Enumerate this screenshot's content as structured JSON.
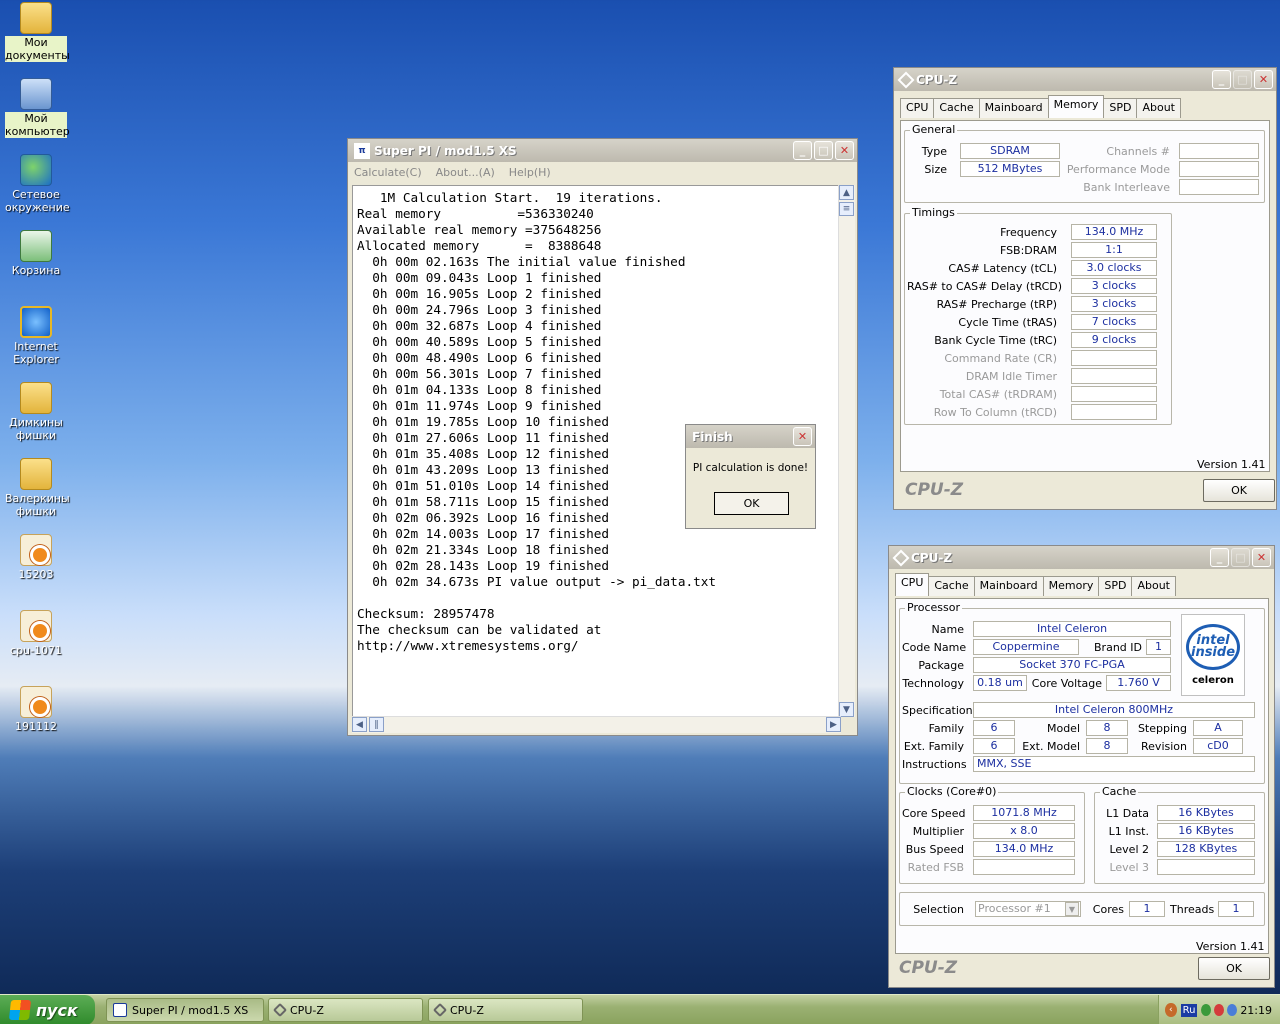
{
  "desktop": {
    "icons": [
      {
        "label": "Мои документы",
        "icon": "folder-docs-icon",
        "selected": true
      },
      {
        "label": "Мой компьютер",
        "icon": "computer-icon",
        "selected": true
      },
      {
        "label": "Сетевое окружение",
        "icon": "network-icon"
      },
      {
        "label": "Корзина",
        "icon": "recycle-bin-icon"
      },
      {
        "label": "Internet Explorer",
        "icon": "internet-explorer-icon"
      },
      {
        "label": "Димкины фишки",
        "icon": "folder-icon"
      },
      {
        "label": "Валеркины фишки",
        "icon": "folder-icon"
      },
      {
        "label": "15203",
        "icon": "jpg-file-icon"
      },
      {
        "label": "cpu-1071",
        "icon": "jpg-file-icon"
      },
      {
        "label": "191112",
        "icon": "jpg-file-icon"
      }
    ]
  },
  "superpi": {
    "title": "Super PI / mod1.5 XS",
    "menu": [
      "Calculate(C)",
      "About...(A)",
      "Help(H)"
    ],
    "output": "   1M Calculation Start.  19 iterations.\nReal memory          =536330240\nAvailable real memory =375648256\nAllocated memory      =  8388648\n  0h 00m 02.163s The initial value finished\n  0h 00m 09.043s Loop 1 finished\n  0h 00m 16.905s Loop 2 finished\n  0h 00m 24.796s Loop 3 finished\n  0h 00m 32.687s Loop 4 finished\n  0h 00m 40.589s Loop 5 finished\n  0h 00m 48.490s Loop 6 finished\n  0h 00m 56.301s Loop 7 finished\n  0h 01m 04.133s Loop 8 finished\n  0h 01m 11.974s Loop 9 finished\n  0h 01m 19.785s Loop 10 finished\n  0h 01m 27.606s Loop 11 finished\n  0h 01m 35.408s Loop 12 finished\n  0h 01m 43.209s Loop 13 finished\n  0h 01m 51.010s Loop 14 finished\n  0h 01m 58.711s Loop 15 finished\n  0h 02m 06.392s Loop 16 finished\n  0h 02m 14.003s Loop 17 finished\n  0h 02m 21.334s Loop 18 finished\n  0h 02m 28.143s Loop 19 finished\n  0h 02m 34.673s PI value output -> pi_data.txt\n\nChecksum: 28957478\nThe checksum can be validated at\nhttp://www.xtremesystems.org/"
  },
  "finish_dialog": {
    "title": "Finish",
    "message": "PI calculation is done!",
    "ok": "OK"
  },
  "cpuz_memory": {
    "title": "CPU-Z",
    "tabs": [
      "CPU",
      "Cache",
      "Mainboard",
      "Memory",
      "SPD",
      "About"
    ],
    "active_tab": "Memory",
    "general": {
      "title": "General",
      "type_label": "Type",
      "type": "SDRAM",
      "size_label": "Size",
      "size": "512 MBytes",
      "channels_label": "Channels #",
      "perf_label": "Performance Mode",
      "interleave_label": "Bank Interleave"
    },
    "timings": {
      "title": "Timings",
      "rows": [
        {
          "label": "Frequency",
          "value": "134.0 MHz"
        },
        {
          "label": "FSB:DRAM",
          "value": "1:1"
        },
        {
          "label": "CAS# Latency (tCL)",
          "value": "3.0 clocks"
        },
        {
          "label": "RAS# to CAS# Delay (tRCD)",
          "value": "3 clocks"
        },
        {
          "label": "RAS# Precharge (tRP)",
          "value": "3 clocks"
        },
        {
          "label": "Cycle Time (tRAS)",
          "value": "7 clocks"
        },
        {
          "label": "Bank Cycle Time (tRC)",
          "value": "9 clocks"
        },
        {
          "label": "Command Rate (CR)",
          "value": ""
        },
        {
          "label": "DRAM Idle Timer",
          "value": ""
        },
        {
          "label": "Total CAS# (tRDRAM)",
          "value": ""
        },
        {
          "label": "Row To Column (tRCD)",
          "value": ""
        }
      ]
    },
    "version": "Version 1.41",
    "brand": "CPU-Z",
    "ok": "OK"
  },
  "cpuz_cpu": {
    "title": "CPU-Z",
    "tabs": [
      "CPU",
      "Cache",
      "Mainboard",
      "Memory",
      "SPD",
      "About"
    ],
    "active_tab": "CPU",
    "processor": {
      "title": "Processor",
      "name_label": "Name",
      "name": "Intel Celeron",
      "codename_label": "Code Name",
      "codename": "Coppermine",
      "brandid_label": "Brand ID",
      "brandid": "1",
      "package_label": "Package",
      "package": "Socket 370 FC-PGA",
      "tech_label": "Technology",
      "tech": "0.18 um",
      "voltage_label": "Core Voltage",
      "voltage": "1.760 V",
      "spec_label": "Specification",
      "spec": "Intel Celeron 800MHz",
      "family_label": "Family",
      "family": "6",
      "model_label": "Model",
      "model": "8",
      "stepping_label": "Stepping",
      "stepping": "A",
      "extfamily_label": "Ext. Family",
      "extfamily": "6",
      "extmodel_label": "Ext. Model",
      "extmodel": "8",
      "revision_label": "Revision",
      "revision": "cD0",
      "instr_label": "Instructions",
      "instr": "MMX, SSE",
      "logo_text": "intel inside",
      "logo_sub": "celeron"
    },
    "clocks": {
      "title": "Clocks (Core#0)",
      "corespeed_label": "Core Speed",
      "corespeed": "1071.8 MHz",
      "mult_label": "Multiplier",
      "mult": "x 8.0",
      "bus_label": "Bus Speed",
      "bus": "134.0 MHz",
      "ratedfsb_label": "Rated FSB"
    },
    "cache": {
      "title": "Cache",
      "l1d_label": "L1 Data",
      "l1d": "16 KBytes",
      "l1i_label": "L1 Inst.",
      "l1i": "16 KBytes",
      "l2_label": "Level 2",
      "l2": "128 KBytes",
      "l3_label": "Level 3"
    },
    "selection_label": "Selection",
    "selection": "Processor #1",
    "cores_label": "Cores",
    "cores": "1",
    "threads_label": "Threads",
    "threads": "1",
    "version": "Version 1.41",
    "brand": "CPU-Z",
    "ok": "OK"
  },
  "taskbar": {
    "start": "пуск",
    "buttons": [
      "Super PI / mod1.5 XS",
      "CPU-Z",
      "CPU-Z"
    ],
    "lang": "Ru",
    "clock": "21:19"
  }
}
